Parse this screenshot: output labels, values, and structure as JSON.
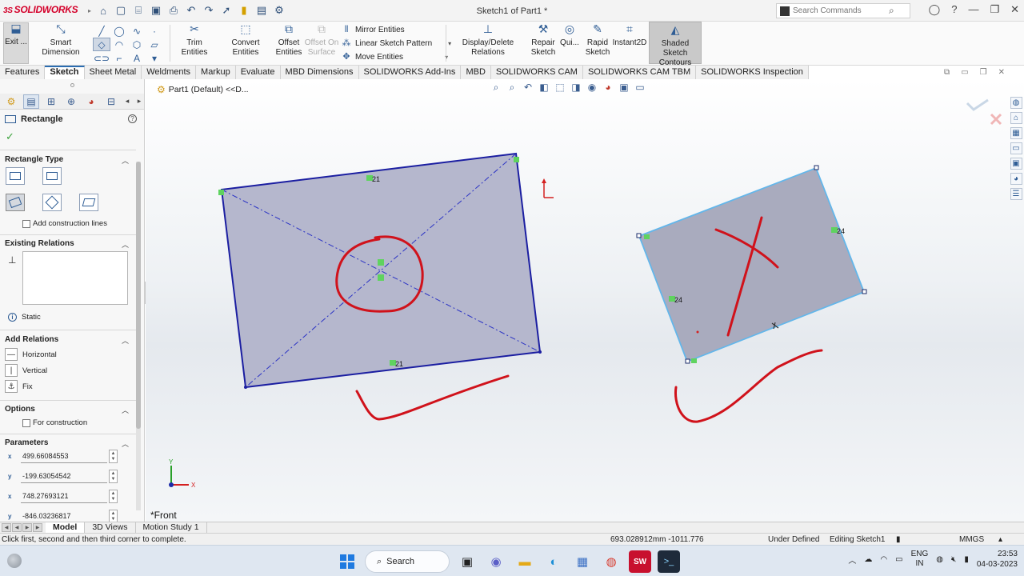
{
  "app": {
    "logo": "SOLIDWORKS",
    "document_title": "Sketch1 of Part1 *",
    "search_placeholder": "Search Commands"
  },
  "ribbon": {
    "exit": "Exit ...",
    "smart_dimension": "Smart Dimension",
    "trim": "Trim Entities",
    "convert": "Convert Entities",
    "offset_line1": "Offset",
    "offset_line2": "Entities",
    "offset_surface_line1": "Offset On",
    "offset_surface_line2": "Surface",
    "mirror": "Mirror Entities",
    "linear_pattern": "Linear Sketch Pattern",
    "move": "Move Entities",
    "display_relations": "Display/Delete Relations",
    "repair_line1": "Repair",
    "repair_line2": "Sketch",
    "quick": "Qui...",
    "rapid_line1": "Rapid",
    "rapid_line2": "Sketch",
    "instant2d": "Instant2D",
    "shaded_line1": "Shaded Sketch",
    "shaded_line2": "Contours"
  },
  "tabs": [
    "Features",
    "Sketch",
    "Sheet Metal",
    "Weldments",
    "Markup",
    "Evaluate",
    "MBD Dimensions",
    "SOLIDWORKS Add-Ins",
    "MBD",
    "SOLIDWORKS CAM",
    "SOLIDWORKS CAM TBM",
    "SOLIDWORKS Inspection"
  ],
  "tree_root": "Part1 (Default) <<D...",
  "property_manager": {
    "title": "Rectangle",
    "rect_type_title": "Rectangle Type",
    "add_construction_lines": "Add construction lines",
    "existing_relations_title": "Existing Relations",
    "static": "Static",
    "add_relations_title": "Add Relations",
    "relations": [
      "Horizontal",
      "Vertical",
      "Fix"
    ],
    "options_title": "Options",
    "for_construction": "For construction",
    "parameters_title": "Parameters",
    "parameters": [
      {
        "label": "x",
        "value": "499.66084553"
      },
      {
        "label": "y",
        "value": "-199.63054542"
      },
      {
        "label": "x",
        "value": "748.27693121"
      },
      {
        "label": "y",
        "value": "-846.03236817"
      }
    ]
  },
  "viewport": {
    "view_name": "*Front",
    "dim_labels": {
      "top": "21",
      "bottom": "21",
      "right_rect_a": "24",
      "right_rect_b": "24"
    },
    "triad_x": "X",
    "triad_y": "Y"
  },
  "bottom_tabs": [
    "Model",
    "3D Views",
    "Motion Study 1"
  ],
  "status": {
    "hint": "Click first, second and then third corner to complete.",
    "coords": "693.028912mm -1011.776",
    "state": "Under Defined",
    "editing": "Editing Sketch1",
    "units": "MMGS"
  },
  "taskbar": {
    "search": "Search",
    "lang_line1": "ENG",
    "lang_line2": "IN",
    "time": "23:53",
    "date": "04-03-2023"
  }
}
